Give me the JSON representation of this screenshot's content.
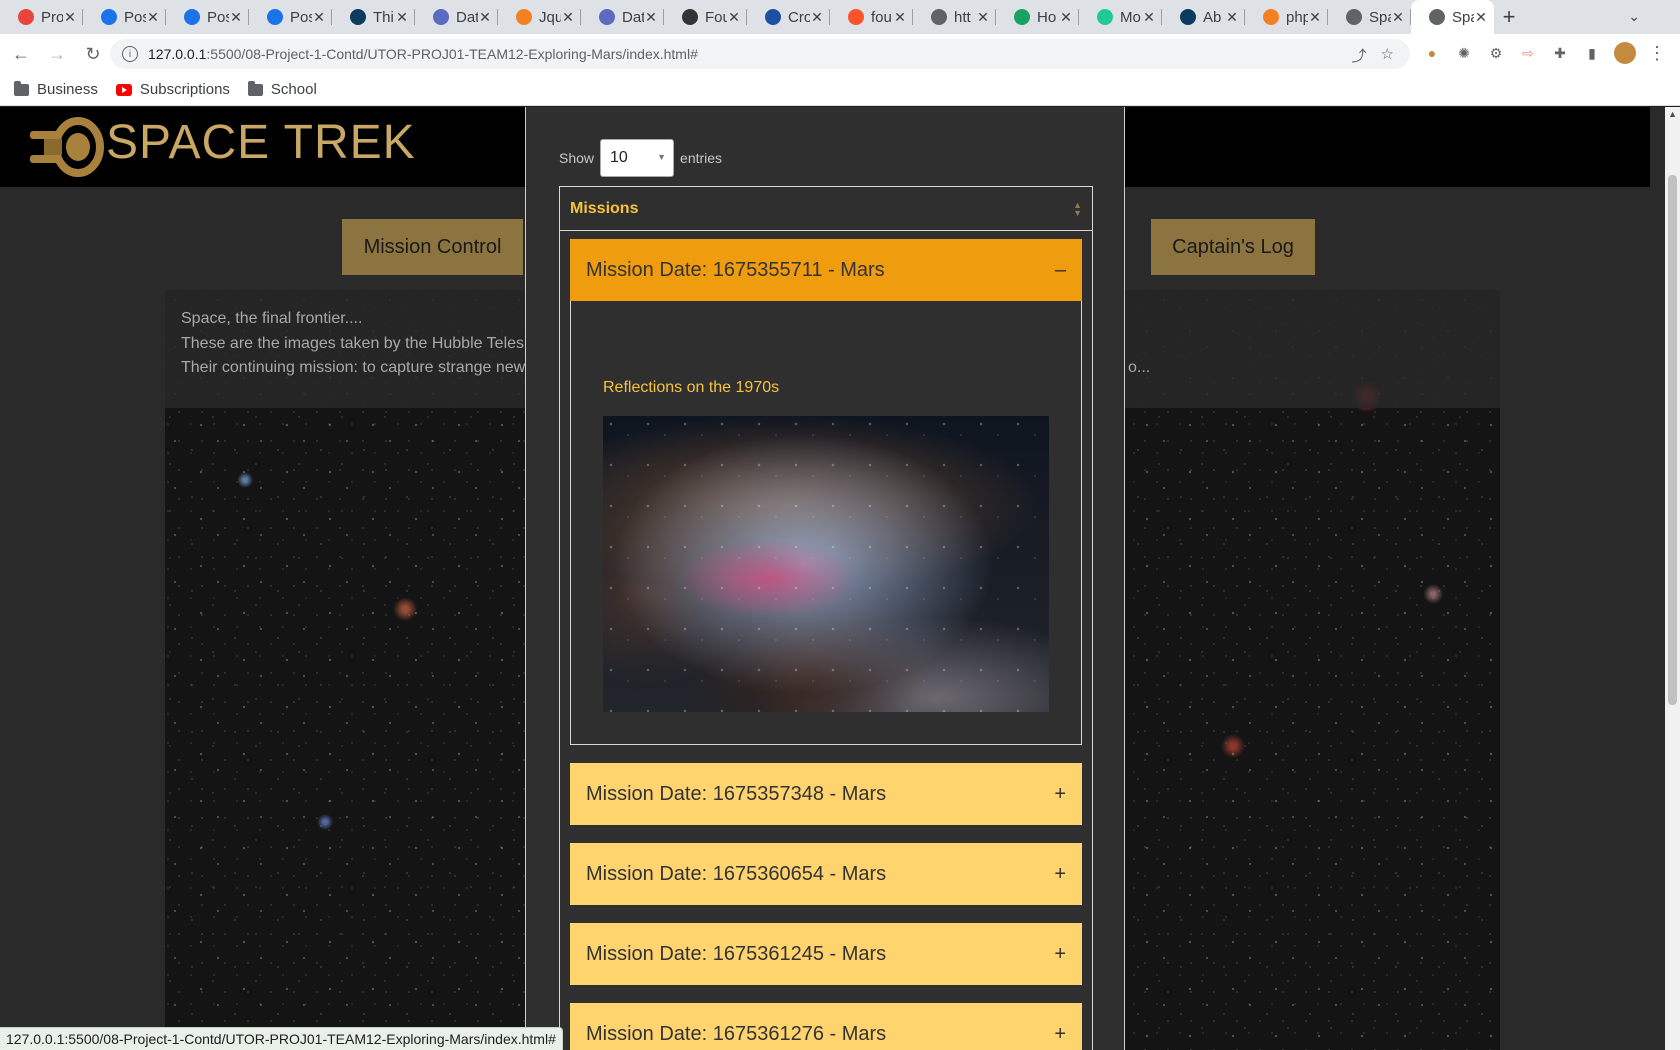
{
  "browser": {
    "tabs": [
      {
        "title": "Pro",
        "color": "#e8453c"
      },
      {
        "title": "Pos",
        "color": "#1a73e8"
      },
      {
        "title": "Pos",
        "color": "#1a73e8"
      },
      {
        "title": "Pos",
        "color": "#1a73e8"
      },
      {
        "title": "Thi",
        "color": "#0c3b5e"
      },
      {
        "title": "Dat",
        "color": "#5c6bc0"
      },
      {
        "title": "Jqu",
        "color": "#f48024"
      },
      {
        "title": "Dat",
        "color": "#5c6bc0"
      },
      {
        "title": "Fou",
        "color": "#333333"
      },
      {
        "title": "Cro",
        "color": "#1e4fa3"
      },
      {
        "title": "fou",
        "color": "#fb542b"
      },
      {
        "title": "htt",
        "color": "#5f6368"
      },
      {
        "title": "Ho",
        "color": "#1aa260"
      },
      {
        "title": "Mo",
        "color": "#20c997"
      },
      {
        "title": "Ab",
        "color": "#0c3b5e"
      },
      {
        "title": "php",
        "color": "#f48024"
      },
      {
        "title": "Spa",
        "color": "#5f6368"
      },
      {
        "title": "Spa",
        "color": "#5f6368"
      }
    ],
    "new_tab_label": "+",
    "address": {
      "host": "127.0.0.1",
      "path": ":5500/08-Project-1-Contd/UTOR-PROJ01-TEAM12-Exploring-Mars/index.html#"
    },
    "bookmarks": [
      {
        "label": "Business",
        "icon": "folder-icon"
      },
      {
        "label": "Subscriptions",
        "icon": "youtube-icon"
      },
      {
        "label": "School",
        "icon": "folder-icon"
      }
    ],
    "status_url": "127.0.0.1:5500/08-Project-1-Contd/UTOR-PROJ01-TEAM12-Exploring-Mars/index.html#"
  },
  "site": {
    "title": "SPACE TREK",
    "nav": {
      "mission_control": "Mission Control",
      "captains_log": "Captain's Log"
    },
    "intro": {
      "line1": "Space, the final frontier....",
      "line2": "These are the images taken by the Hubble Teles",
      "line3": "Their continuing mission: to capture strange new",
      "line3_tail": "o..."
    }
  },
  "modal": {
    "length_prefix": "Show",
    "length_value": "10",
    "length_suffix": "entries",
    "column_header": "Missions",
    "missions": [
      {
        "label": "Mission Date: 1675355711 - Mars",
        "open": true,
        "toggle": "–",
        "caption": "Reflections on the 1970s"
      },
      {
        "label": "Mission Date: 1675357348 - Mars",
        "open": false,
        "toggle": "+"
      },
      {
        "label": "Mission Date: 1675360654 - Mars",
        "open": false,
        "toggle": "+"
      },
      {
        "label": "Mission Date: 1675361245 - Mars",
        "open": false,
        "toggle": "+"
      },
      {
        "label": "Mission Date: 1675361276 - Mars",
        "open": false,
        "toggle": "+"
      }
    ]
  },
  "colors": {
    "accent_gold": "#c9a765",
    "nav_button": "#8c7441",
    "open_header": "#ef9d0f",
    "closed_header": "#ffd46f",
    "caption": "#f7c23c"
  }
}
